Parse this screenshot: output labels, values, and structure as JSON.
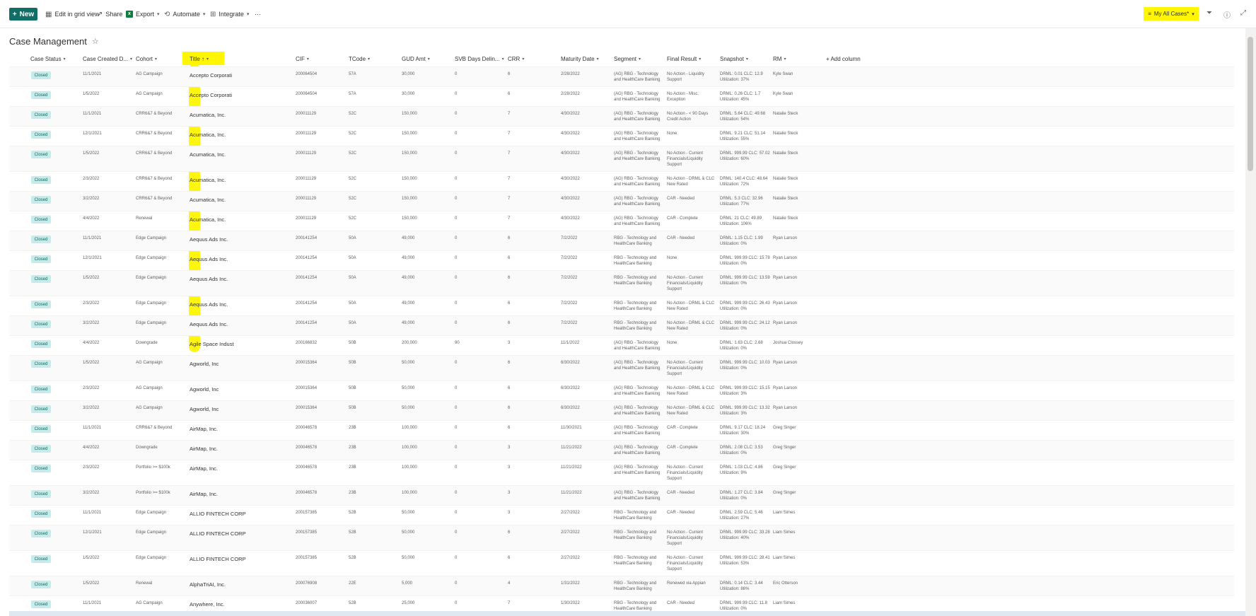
{
  "toolbar": {
    "new_label": "New",
    "edit_grid_label": "Edit in grid view",
    "share_label": "Share",
    "export_label": "Export",
    "automate_label": "Automate",
    "integrate_label": "Integrate",
    "more_label": "···",
    "view_selector_label": "My All Cases*",
    "colors": {
      "new_button": "#106e66",
      "highlight": "#fff600"
    }
  },
  "page": {
    "title": "Case Management"
  },
  "columns": [
    "Case Status",
    "Case Created D...",
    "Cohort",
    "Title ↑",
    "CIF",
    "TCode",
    "GUD Amt",
    "SVB Days Delin...",
    "CRR",
    "Maturity Date",
    "Segment",
    "Final Result",
    "Snapshot",
    "RM",
    "+ Add column"
  ],
  "rows": [
    {
      "status": "Closed",
      "created": "11/1/2021",
      "cohort": "AG Campaign",
      "title": "Accepto Corporati",
      "cif": "200064504",
      "tcode": "57A",
      "gud": "30,000",
      "days": "0",
      "crr": "6",
      "maturity": "2/28/2022",
      "segment": "(AG) RBG - Technology and HealthCare Banking",
      "result": "No Action - Liquidity Support",
      "snapshot": "DRML: 0.01 CLC: 12.9 Utilization: 37%",
      "rm": "Kyle Swan"
    },
    {
      "status": "Closed",
      "created": "1/5/2022",
      "cohort": "AG Campaign",
      "title": "Accepto Corporati",
      "cif": "200064504",
      "tcode": "57A",
      "gud": "30,000",
      "days": "0",
      "crr": "6",
      "maturity": "2/28/2022",
      "segment": "(AG) RBG - Technology and HealthCare Banking",
      "result": "No Action - Misc. Exception",
      "snapshot": "DRML: 0.26 CLC: 1.7 Utilization: 45%",
      "rm": "Kyle Swan"
    },
    {
      "status": "Closed",
      "created": "11/1/2021",
      "cohort": "CRR6&7 & Beyond",
      "title": "Acumatica, Inc.",
      "cif": "200011129",
      "tcode": "52C",
      "gud": "150,000",
      "days": "0",
      "crr": "7",
      "maturity": "4/30/2022",
      "segment": "(AG) RBG - Technology and HealthCare Banking",
      "result": "No Action - < 90 Days Credit Action",
      "snapshot": "DRML: 5.64 CLC: 49.68 Utilization: 54%",
      "rm": "Natalie Steck"
    },
    {
      "status": "Closed",
      "created": "12/1/2021",
      "cohort": "CRR6&7 & Beyond",
      "title": "Acumatica, Inc.",
      "cif": "200011129",
      "tcode": "52C",
      "gud": "150,000",
      "days": "0",
      "crr": "7",
      "maturity": "4/30/2022",
      "segment": "(AG) RBG - Technology and HealthCare Banking",
      "result": "None",
      "snapshot": "DRML: 9.21 CLC: 51.14 Utilization: 55%",
      "rm": "Natalie Steck"
    },
    {
      "status": "Closed",
      "created": "1/5/2022",
      "cohort": "CRR6&7 & Beyond",
      "title": "Acumatica, Inc.",
      "cif": "200011129",
      "tcode": "52C",
      "gud": "150,000",
      "days": "0",
      "crr": "7",
      "maturity": "4/30/2022",
      "segment": "(AG) RBG - Technology and HealthCare Banking",
      "result": "No Action - Current Financials/Liquidity Support",
      "snapshot": "DRML: 999.99 CLC: 57.02 Utilization: 60%",
      "rm": "Natalie Steck"
    },
    {
      "status": "Closed",
      "created": "2/3/2022",
      "cohort": "CRR6&7 & Beyond",
      "title": "Acumatica, Inc.",
      "cif": "200011129",
      "tcode": "52C",
      "gud": "150,000",
      "days": "0",
      "crr": "7",
      "maturity": "4/30/2022",
      "segment": "(AG) RBG - Technology and HealthCare Banking",
      "result": "No Action - DRML & CLC New Rated",
      "snapshot": "DRML: 140.4 CLC: 48.64 Utilization: 72%",
      "rm": "Natalie Steck"
    },
    {
      "status": "Closed",
      "created": "3/2/2022",
      "cohort": "CRR6&7 & Beyond",
      "title": "Acumatica, Inc.",
      "cif": "200011129",
      "tcode": "52C",
      "gud": "150,000",
      "days": "0",
      "crr": "7",
      "maturity": "4/30/2022",
      "segment": "(AG) RBG - Technology and HealthCare Banking",
      "result": "CAR - Needed",
      "snapshot": "DRML: 5.3 CLC: 32.96 Utilization: 77%",
      "rm": "Natalie Steck"
    },
    {
      "status": "Closed",
      "created": "4/4/2022",
      "cohort": "Renewal",
      "title": "Acumatica, Inc.",
      "cif": "200011129",
      "tcode": "52C",
      "gud": "150,000",
      "days": "0",
      "crr": "7",
      "maturity": "4/30/2022",
      "segment": "(AG) RBG - Technology and HealthCare Banking",
      "result": "CAR - Complete",
      "snapshot": "DRML: 21 CLC: 49.89 Utilization: 106%",
      "rm": "Natalie Steck"
    },
    {
      "status": "Closed",
      "created": "11/1/2021",
      "cohort": "Edge Campaign",
      "title": "Aequus Ads Inc.",
      "cif": "200141254",
      "tcode": "50A",
      "gud": "49,000",
      "days": "0",
      "crr": "6",
      "maturity": "7/2/2022",
      "segment": "RBG - Technology and HealthCare Banking",
      "result": "CAR - Needed",
      "snapshot": "DRML: 1.15 CLC: 1.99 Utilization: 0%",
      "rm": "Ryan Larson"
    },
    {
      "status": "Closed",
      "created": "12/1/2021",
      "cohort": "Edge Campaign",
      "title": "Aequus Ads Inc.",
      "cif": "200141254",
      "tcode": "50A",
      "gud": "49,000",
      "days": "0",
      "crr": "6",
      "maturity": "7/2/2022",
      "segment": "RBG - Technology and HealthCare Banking",
      "result": "None",
      "snapshot": "DRML: 999.99 CLC: 15.78 Utilization: 0%",
      "rm": "Ryan Larson"
    },
    {
      "status": "Closed",
      "created": "1/5/2022",
      "cohort": "Edge Campaign",
      "title": "Aequus Ads Inc.",
      "cif": "200141254",
      "tcode": "50A",
      "gud": "49,000",
      "days": "0",
      "crr": "6",
      "maturity": "7/2/2022",
      "segment": "RBG - Technology and HealthCare Banking",
      "result": "No Action - Current Financials/Liquidity Support",
      "snapshot": "DRML: 999.99 CLC: 13.59 Utilization: 0%",
      "rm": "Ryan Larson"
    },
    {
      "status": "Closed",
      "created": "2/3/2022",
      "cohort": "Edge Campaign",
      "title": "Aequus Ads Inc.",
      "cif": "200141254",
      "tcode": "50A",
      "gud": "49,000",
      "days": "0",
      "crr": "6",
      "maturity": "7/2/2022",
      "segment": "RBG - Technology and HealthCare Banking",
      "result": "No Action - DRML & CLC New Rated",
      "snapshot": "DRML: 999.99 CLC: 26.43 Utilization: 0%",
      "rm": "Ryan Larson"
    },
    {
      "status": "Closed",
      "created": "3/2/2022",
      "cohort": "Edge Campaign",
      "title": "Aequus Ads Inc.",
      "cif": "200141254",
      "tcode": "50A",
      "gud": "49,000",
      "days": "0",
      "crr": "6",
      "maturity": "7/2/2022",
      "segment": "RBG - Technology and HealthCare Banking",
      "result": "No Action - DRML & CLC New Rated",
      "snapshot": "DRML: 999.99 CLC: 24.12 Utilization: 0%",
      "rm": "Ryan Larson"
    },
    {
      "status": "Closed",
      "created": "4/4/2022",
      "cohort": "Downgrade",
      "title": "Agile Space Indust",
      "cif": "200166832",
      "tcode": "50B",
      "gud": "200,000",
      "days": "90",
      "crr": "3",
      "maturity": "11/1/2022",
      "segment": "(AG) RBG - Technology and HealthCare Banking",
      "result": "None",
      "snapshot": "DRML: 1.63 CLC: 2.68 Utilization: 0%",
      "rm": "Joshua Clossey"
    },
    {
      "status": "Closed",
      "created": "1/5/2022",
      "cohort": "AG Campaign",
      "title": "Agworld, Inc",
      "cif": "200015364",
      "tcode": "50B",
      "gud": "50,000",
      "days": "0",
      "crr": "6",
      "maturity": "6/30/2022",
      "segment": "(AG) RBG - Technology and HealthCare Banking",
      "result": "No Action - Current Financials/Liquidity Support",
      "snapshot": "DRML: 999.99 CLC: 10.03 Utilization: 0%",
      "rm": "Ryan Larson"
    },
    {
      "status": "Closed",
      "created": "2/3/2022",
      "cohort": "AG Campaign",
      "title": "Agworld, Inc",
      "cif": "200015364",
      "tcode": "50B",
      "gud": "50,000",
      "days": "0",
      "crr": "6",
      "maturity": "6/30/2022",
      "segment": "(AG) RBG - Technology and HealthCare Banking",
      "result": "No Action - DRML & CLC New Rated",
      "snapshot": "DRML: 999.99 CLC: 15.15 Utilization: 3%",
      "rm": "Ryan Larson"
    },
    {
      "status": "Closed",
      "created": "3/2/2022",
      "cohort": "AG Campaign",
      "title": "Agworld, Inc",
      "cif": "200015364",
      "tcode": "50B",
      "gud": "50,000",
      "days": "0",
      "crr": "6",
      "maturity": "6/30/2022",
      "segment": "(AG) RBG - Technology and HealthCare Banking",
      "result": "No Action - DRML & CLC New Rated",
      "snapshot": "DRML: 999.99 CLC: 13.32 Utilization: 3%",
      "rm": "Ryan Larson"
    },
    {
      "status": "Closed",
      "created": "11/1/2021",
      "cohort": "CRR6&7 & Beyond",
      "title": "AirMap, Inc.",
      "cif": "200046578",
      "tcode": "23B",
      "gud": "100,000",
      "days": "0",
      "crr": "6",
      "maturity": "11/30/2021",
      "segment": "(AG) RBG - Technology and HealthCare Banking",
      "result": "CAR - Complete",
      "snapshot": "DRML: 9.17 CLC: 18.24 Utilization: 30%",
      "rm": "Greg Singer"
    },
    {
      "status": "Closed",
      "created": "4/4/2022",
      "cohort": "Downgrade",
      "title": "AirMap, Inc.",
      "cif": "200046578",
      "tcode": "23B",
      "gud": "100,000",
      "days": "0",
      "crr": "3",
      "maturity": "11/21/2022",
      "segment": "(AG) RBG - Technology and HealthCare Banking",
      "result": "CAR - Complete",
      "snapshot": "DRML: 2.08 CLC: 3.53 Utilization: 0%",
      "rm": "Greg Singer"
    },
    {
      "status": "Closed",
      "created": "2/3/2022",
      "cohort": "Portfolio >= $100k",
      "title": "AirMap, Inc.",
      "cif": "200046578",
      "tcode": "23B",
      "gud": "100,000",
      "days": "0",
      "crr": "3",
      "maturity": "11/21/2022",
      "segment": "(AG) RBG - Technology and HealthCare Banking",
      "result": "No Action - Current Financials/Liquidity Support",
      "snapshot": "DRML: 1.03 CLC: 4.86 Utilization: 9%",
      "rm": "Greg Singer"
    },
    {
      "status": "Closed",
      "created": "3/2/2022",
      "cohort": "Portfolio >= $100k",
      "title": "AirMap, Inc.",
      "cif": "200046578",
      "tcode": "23B",
      "gud": "100,000",
      "days": "0",
      "crr": "3",
      "maturity": "11/21/2022",
      "segment": "(AG) RBG - Technology and HealthCare Banking",
      "result": "CAR - Needed",
      "snapshot": "DRML: 1.27 CLC: 3.84 Utilization: 0%",
      "rm": "Greg Singer"
    },
    {
      "status": "Closed",
      "created": "11/1/2021",
      "cohort": "Edge Campaign",
      "title": "ALLIO FINTECH CORP",
      "cif": "200157385",
      "tcode": "52B",
      "gud": "50,000",
      "days": "0",
      "crr": "3",
      "maturity": "2/27/2022",
      "segment": "RBG - Technology and HealthCare Banking",
      "result": "CAR - Needed",
      "snapshot": "DRML: 2.59 CLC: 5.46 Utilization: 27%",
      "rm": "Liam Simes"
    },
    {
      "status": "Closed",
      "created": "12/1/2021",
      "cohort": "Edge Campaign",
      "title": "ALLIO FINTECH CORP",
      "cif": "200157385",
      "tcode": "52B",
      "gud": "50,000",
      "days": "0",
      "crr": "6",
      "maturity": "2/27/2022",
      "segment": "RBG - Technology and HealthCare Banking",
      "result": "No Action - Current Financials/Liquidity Support",
      "snapshot": "DRML: 999.99 CLC: 33.28 Utilization: 40%",
      "rm": "Liam Simes"
    },
    {
      "status": "Closed",
      "created": "1/5/2022",
      "cohort": "Edge Campaign",
      "title": "ALLIO FINTECH CORP",
      "cif": "200157385",
      "tcode": "52B",
      "gud": "50,000",
      "days": "0",
      "crr": "6",
      "maturity": "2/27/2022",
      "segment": "RBG - Technology and HealthCare Banking",
      "result": "No Action - Current Financials/Liquidity Support",
      "snapshot": "DRML: 999.99 CLC: 28.41 Utilization: 53%",
      "rm": "Liam Simes"
    },
    {
      "status": "Closed",
      "created": "1/5/2022",
      "cohort": "Renewal",
      "title": "AlphaTriAI, Inc.",
      "cif": "200076908",
      "tcode": "22E",
      "gud": "5,000",
      "days": "0",
      "crr": "4",
      "maturity": "1/31/2022",
      "segment": "RBG - Technology and HealthCare Banking",
      "result": "Renewed via Appian",
      "snapshot": "DRML: 0.14 CLC: 3.44 Utilization: 86%",
      "rm": "Eric Otterson"
    },
    {
      "status": "Closed",
      "created": "11/1/2021",
      "cohort": "AG Campaign",
      "title": "Anywhere, Inc.",
      "cif": "200036007",
      "tcode": "52B",
      "gud": "25,000",
      "days": "0",
      "crr": "7",
      "maturity": "1/30/2022",
      "segment": "RBG - Technology and HealthCare Banking",
      "result": "CAR - Needed",
      "snapshot": "DRML: 999.99 CLC: 11.8 Utilization: 0%",
      "rm": "Liam Simes"
    }
  ]
}
